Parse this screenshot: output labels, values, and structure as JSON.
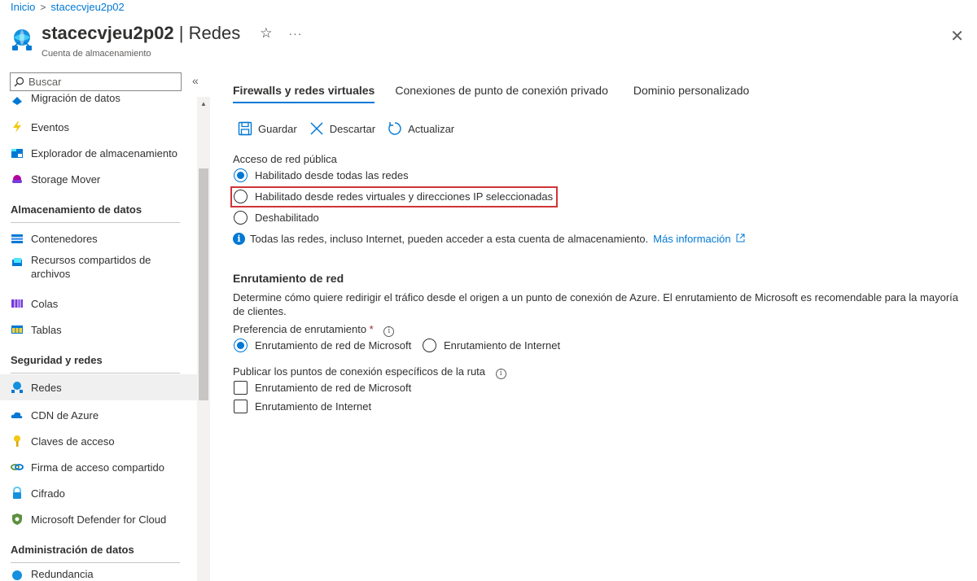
{
  "breadcrumb": {
    "home": "Inicio",
    "separator": ">",
    "current": "stacecvjeu2p02"
  },
  "header": {
    "resource_name": "stacecvjeu2p02",
    "page_name": "| Redes",
    "subtitle": "Cuenta de almacenamiento",
    "star_icon": "☆",
    "more_icon": "···",
    "close_icon": "✕"
  },
  "sidebar": {
    "search_placeholder": "Buscar",
    "collapse_icon": "«",
    "items": [
      {
        "label": "Migración de datos",
        "icon": "migration-icon"
      },
      {
        "label": "Eventos",
        "icon": "events-icon"
      },
      {
        "label": "Explorador de almacenamiento",
        "icon": "storage-explorer-icon"
      },
      {
        "label": "Storage Mover",
        "icon": "storage-mover-icon"
      }
    ],
    "sections": [
      {
        "title": "Almacenamiento de datos",
        "items": [
          {
            "label": "Contenedores",
            "icon": "containers-icon"
          },
          {
            "label": "Recursos compartidos de archivos",
            "icon": "file-shares-icon"
          },
          {
            "label": "Colas",
            "icon": "queues-icon"
          },
          {
            "label": "Tablas",
            "icon": "tables-icon"
          }
        ]
      },
      {
        "title": "Seguridad y redes",
        "items": [
          {
            "label": "Redes",
            "icon": "networking-icon",
            "active": true
          },
          {
            "label": "CDN de Azure",
            "icon": "cdn-icon"
          },
          {
            "label": "Claves de acceso",
            "icon": "key-icon"
          },
          {
            "label": "Firma de acceso compartido",
            "icon": "sas-icon"
          },
          {
            "label": "Cifrado",
            "icon": "lock-icon"
          },
          {
            "label": "Microsoft Defender for Cloud",
            "icon": "shield-icon"
          }
        ]
      },
      {
        "title": "Administración de datos",
        "items": [
          {
            "label": "Redundancia",
            "icon": "redundancy-icon"
          }
        ]
      }
    ]
  },
  "tabs": [
    {
      "label": "Firewalls y redes virtuales",
      "active": true
    },
    {
      "label": "Conexiones de punto de conexión privado"
    },
    {
      "label": "Dominio personalizado"
    }
  ],
  "toolbar": {
    "save": "Guardar",
    "discard": "Descartar",
    "refresh": "Actualizar"
  },
  "public_access": {
    "label": "Acceso de red pública",
    "options": [
      {
        "label": "Habilitado desde todas las redes",
        "checked": true
      },
      {
        "label": "Habilitado desde redes virtuales y direcciones IP seleccionadas",
        "checked": false
      },
      {
        "label": "Deshabilitado",
        "checked": false
      }
    ],
    "info_text": "Todas las redes, incluso Internet, pueden acceder a esta cuenta de almacenamiento.",
    "info_link": "Más información"
  },
  "routing": {
    "title": "Enrutamiento de red",
    "description": "Determine cómo quiere redirigir el tráfico desde el origen a un punto de conexión de Azure. El enrutamiento de Microsoft es recomendable para la mayoría de clientes.",
    "preference_label": "Preferencia de enrutamiento",
    "required_mark": "*",
    "preference_options": [
      {
        "label": "Enrutamiento de red de Microsoft",
        "checked": true
      },
      {
        "label": "Enrutamiento de Internet",
        "checked": false
      }
    ],
    "publish_label": "Publicar los puntos de conexión específicos de la ruta",
    "publish_options": [
      {
        "label": "Enrutamiento de red de Microsoft",
        "checked": false
      },
      {
        "label": "Enrutamiento de Internet",
        "checked": false
      }
    ]
  },
  "colors": {
    "accent": "#0078d4",
    "highlight_border": "#d13438",
    "active_nav": "#f0f0f0"
  }
}
